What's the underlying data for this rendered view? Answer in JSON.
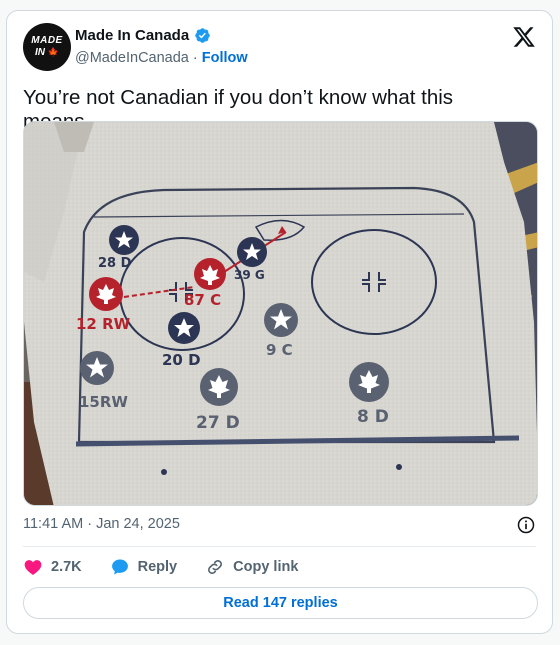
{
  "author": {
    "display_name": "Made In Canada",
    "handle": "@MadeInCanada",
    "follow_label": "Follow",
    "avatar_line1": "MADE",
    "avatar_line2": "IN",
    "avatar_leaf": "🍁"
  },
  "tweet": {
    "text": "You’re not Canadian if you don’t know what this means…",
    "timestamp": "11:41 AM · Jan 24, 2025"
  },
  "image": {
    "player_labels": [
      "28 D",
      "12 RW",
      "87 C",
      "39 G",
      "20 D",
      "9 C",
      "15RW",
      "27 D",
      "8 D"
    ]
  },
  "actions": {
    "likes": "2.7K",
    "reply_label": "Reply",
    "copy_link_label": "Copy link"
  },
  "footer": {
    "read_replies": "Read 147 replies"
  },
  "colors": {
    "like": "#f91880",
    "link": "#006fd6",
    "reply": "#1d9bf0",
    "navy": "#2c3553",
    "red": "#b5222c",
    "shirt": "#d6d4cf"
  }
}
